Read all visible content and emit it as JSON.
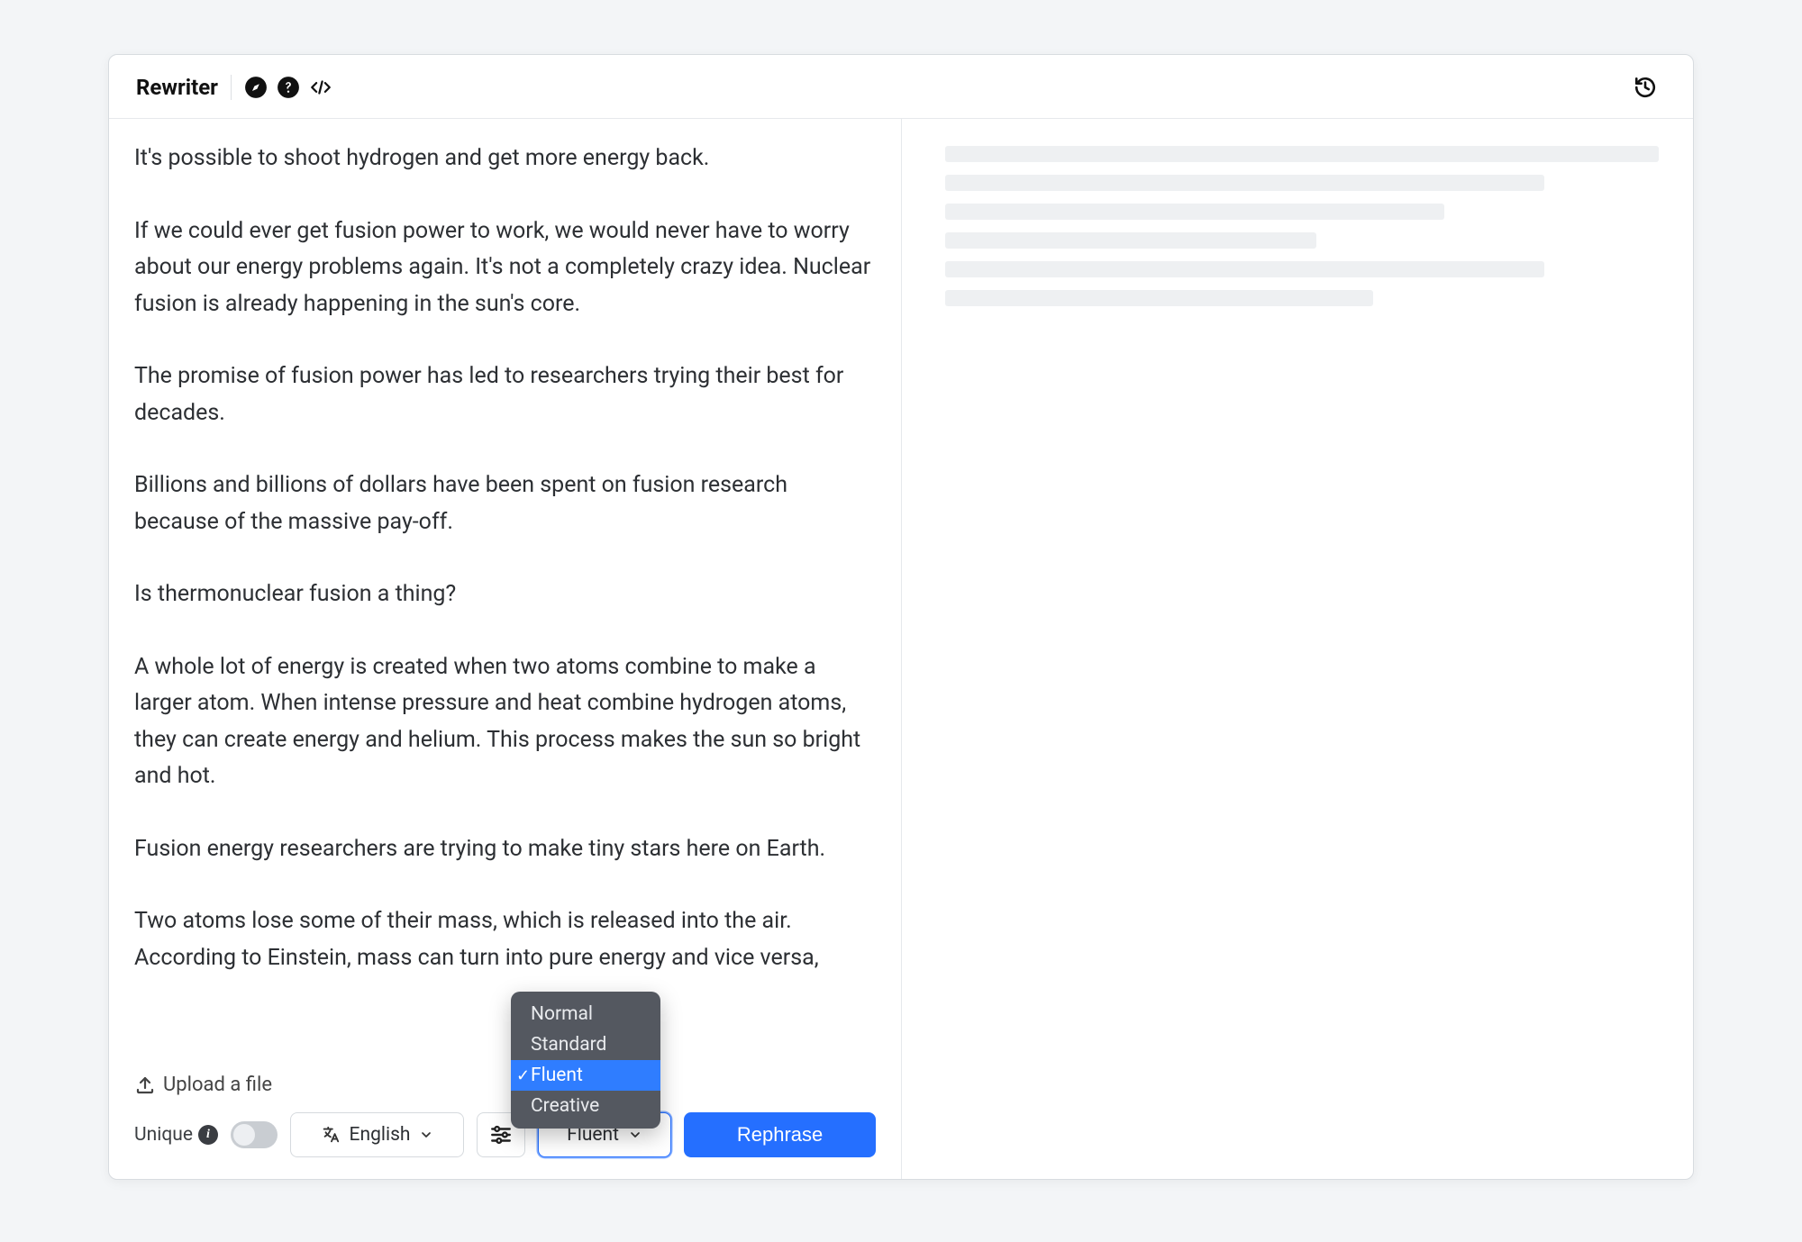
{
  "header": {
    "title": "Rewriter"
  },
  "content": {
    "paragraphs": [
      "It's possible to shoot hydrogen and get more energy back.",
      "If we could ever get fusion power to work, we would never have to worry about our energy problems again. It's not a completely crazy idea. Nuclear fusion is already happening in the sun's core.",
      "The promise of fusion power has led to researchers trying their best for decades.",
      "Billions and billions of dollars have been spent on fusion research because of the massive pay-off.",
      "Is thermonuclear fusion a thing?",
      "A whole lot of energy is created when two atoms combine to make a larger atom. When intense pressure and heat combine hydrogen atoms, they can create energy and helium. This process makes the sun so bright and hot.",
      "Fusion energy researchers are trying to make tiny stars here on Earth.",
      "Two atoms lose some of their mass, which is released into the air. According to Einstein, mass can turn into pure energy and vice versa,"
    ]
  },
  "upload": {
    "label": "Upload a file"
  },
  "bottom": {
    "unique_label": "Unique",
    "language": "English",
    "style_selected": "Fluent",
    "rephrase_label": "Rephrase"
  },
  "dropdown": {
    "options": [
      "Normal",
      "Standard",
      "Fluent",
      "Creative"
    ],
    "selected_index": 2
  },
  "skeleton_widths_pct": [
    100,
    84,
    70,
    52,
    84,
    60
  ]
}
